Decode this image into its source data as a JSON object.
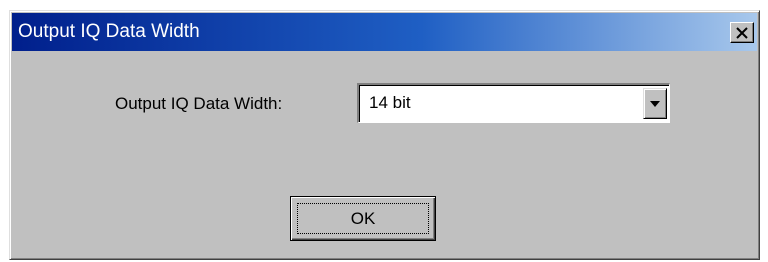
{
  "window": {
    "title": "Output IQ Data Width",
    "close_icon": "close-x-icon"
  },
  "form": {
    "label": "Output IQ Data Width:",
    "select_value": "14 bit",
    "dropdown_icon": "chevron-down-icon"
  },
  "buttons": {
    "ok_label": "OK"
  }
}
